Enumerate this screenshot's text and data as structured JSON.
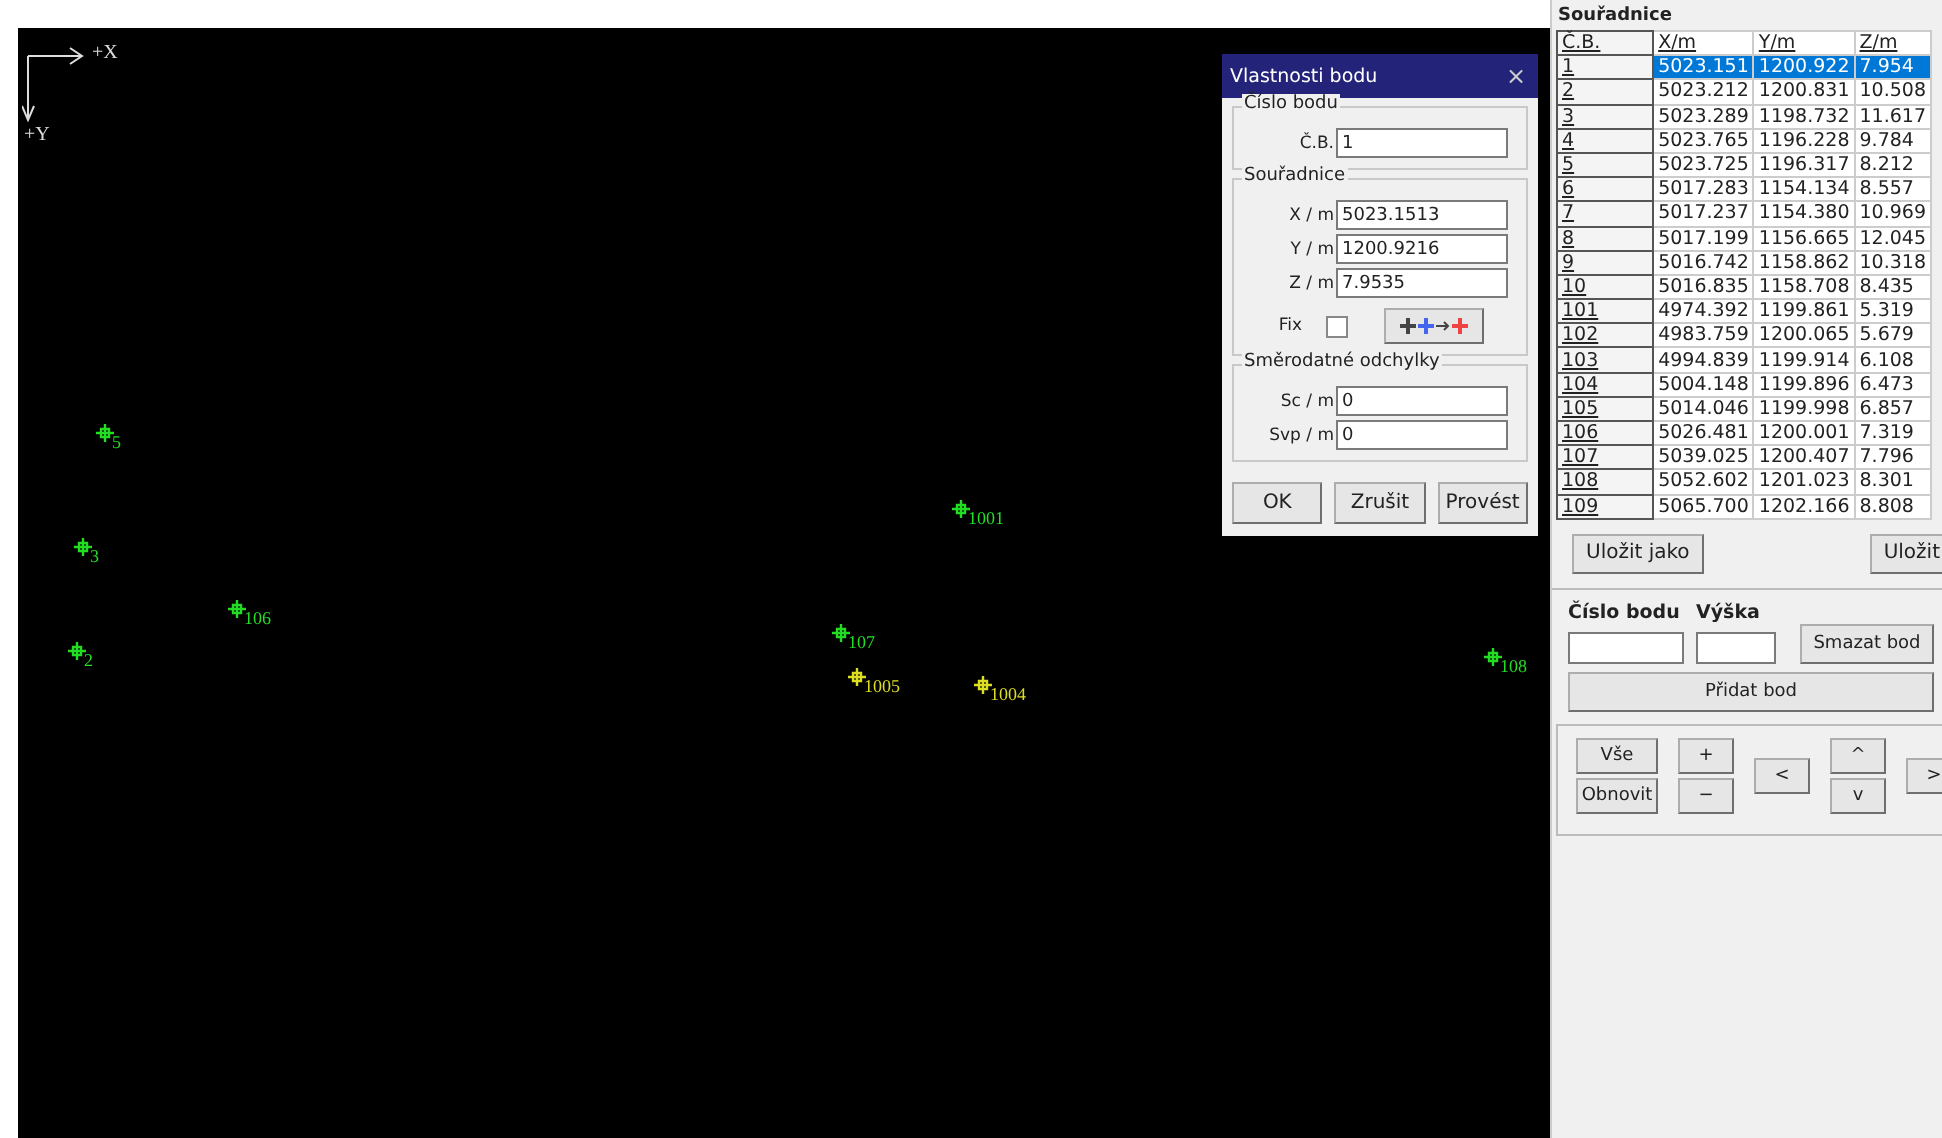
{
  "canvas": {
    "x_axis_label": "+X",
    "y_axis_label": "+Y",
    "points": [
      {
        "label": "5",
        "color": "#22dd22"
      },
      {
        "label": "3",
        "color": "#22dd22"
      },
      {
        "label": "106",
        "color": "#22dd22"
      },
      {
        "label": "2",
        "color": "#22dd22"
      },
      {
        "label": "1001",
        "color": "#22dd22"
      },
      {
        "label": "107",
        "color": "#22dd22"
      },
      {
        "label": "1005",
        "color": "#dddd22"
      },
      {
        "label": "1004",
        "color": "#dddd22"
      },
      {
        "label": "108",
        "color": "#22dd22"
      }
    ]
  },
  "dialog": {
    "title": "Vlastnosti bodu",
    "close_glyph": "×",
    "point_group": {
      "title": "Číslo bodu",
      "fields": [
        {
          "label": "Č.B.",
          "value": "1"
        }
      ]
    },
    "coordinates_group": {
      "title": "Souřadnice",
      "fields": [
        {
          "label": "X / m",
          "value": "5023.1513"
        },
        {
          "label": "Y / m",
          "value": "1200.9216"
        },
        {
          "label": "Z / m",
          "value": "7.9535"
        }
      ],
      "fix": {
        "label": "Fix",
        "checked": false
      }
    },
    "deviations_group": {
      "title": "Směrodatné odchylky",
      "fields": [
        {
          "label": "Sc / m",
          "value": "0"
        },
        {
          "label": "Svp / m",
          "value": "0"
        }
      ]
    },
    "buttons": [
      "OK",
      "Zrušit",
      "Provést"
    ]
  },
  "panel": {
    "title": "Souřadnice",
    "table": {
      "columns": [
        "Č.B.",
        "X/m",
        "Y/m",
        "Z/m"
      ],
      "rows": [
        {
          "cells": [
            "1",
            "5023.151",
            "1200.922",
            "7.954"
          ],
          "selected": true
        },
        {
          "cells": [
            "2",
            "5023.212",
            "1200.831",
            "10.508"
          ],
          "selected": false
        },
        {
          "cells": [
            "3",
            "5023.289",
            "1198.732",
            "11.617"
          ],
          "selected": false
        },
        {
          "cells": [
            "4",
            "5023.765",
            "1196.228",
            "9.784"
          ],
          "selected": false
        },
        {
          "cells": [
            "5",
            "5023.725",
            "1196.317",
            "8.212"
          ],
          "selected": false
        },
        {
          "cells": [
            "6",
            "5017.283",
            "1154.134",
            "8.557"
          ],
          "selected": false
        },
        {
          "cells": [
            "7",
            "5017.237",
            "1154.380",
            "10.969"
          ],
          "selected": false
        },
        {
          "cells": [
            "8",
            "5017.199",
            "1156.665",
            "12.045"
          ],
          "selected": false
        },
        {
          "cells": [
            "9",
            "5016.742",
            "1158.862",
            "10.318"
          ],
          "selected": false
        },
        {
          "cells": [
            "10",
            "5016.835",
            "1158.708",
            "8.435"
          ],
          "selected": false
        },
        {
          "cells": [
            "101",
            "4974.392",
            "1199.861",
            "5.319"
          ],
          "selected": false
        },
        {
          "cells": [
            "102",
            "4983.759",
            "1200.065",
            "5.679"
          ],
          "selected": false
        },
        {
          "cells": [
            "103",
            "4994.839",
            "1199.914",
            "6.108"
          ],
          "selected": false
        },
        {
          "cells": [
            "104",
            "5004.148",
            "1199.896",
            "6.473"
          ],
          "selected": false
        },
        {
          "cells": [
            "105",
            "5014.046",
            "1199.998",
            "6.857"
          ],
          "selected": false
        },
        {
          "cells": [
            "106",
            "5026.481",
            "1200.001",
            "7.319"
          ],
          "selected": false
        },
        {
          "cells": [
            "107",
            "5039.025",
            "1200.407",
            "7.796"
          ],
          "selected": false
        },
        {
          "cells": [
            "108",
            "5052.602",
            "1201.023",
            "8.301"
          ],
          "selected": false
        },
        {
          "cells": [
            "109",
            "5065.700",
            "1202.166",
            "8.808"
          ],
          "selected": false
        }
      ]
    },
    "save_as_button": "Uložit jako",
    "save_button": "Uložit",
    "point_number_label": "Číslo bodu",
    "height_label": "Výška",
    "delete_button": "Smazat bod",
    "add_button": "Přidat bod",
    "view_buttons": [
      "Vše",
      "+",
      "^",
      "<",
      ">",
      "Obnovit",
      "−",
      "v"
    ]
  }
}
